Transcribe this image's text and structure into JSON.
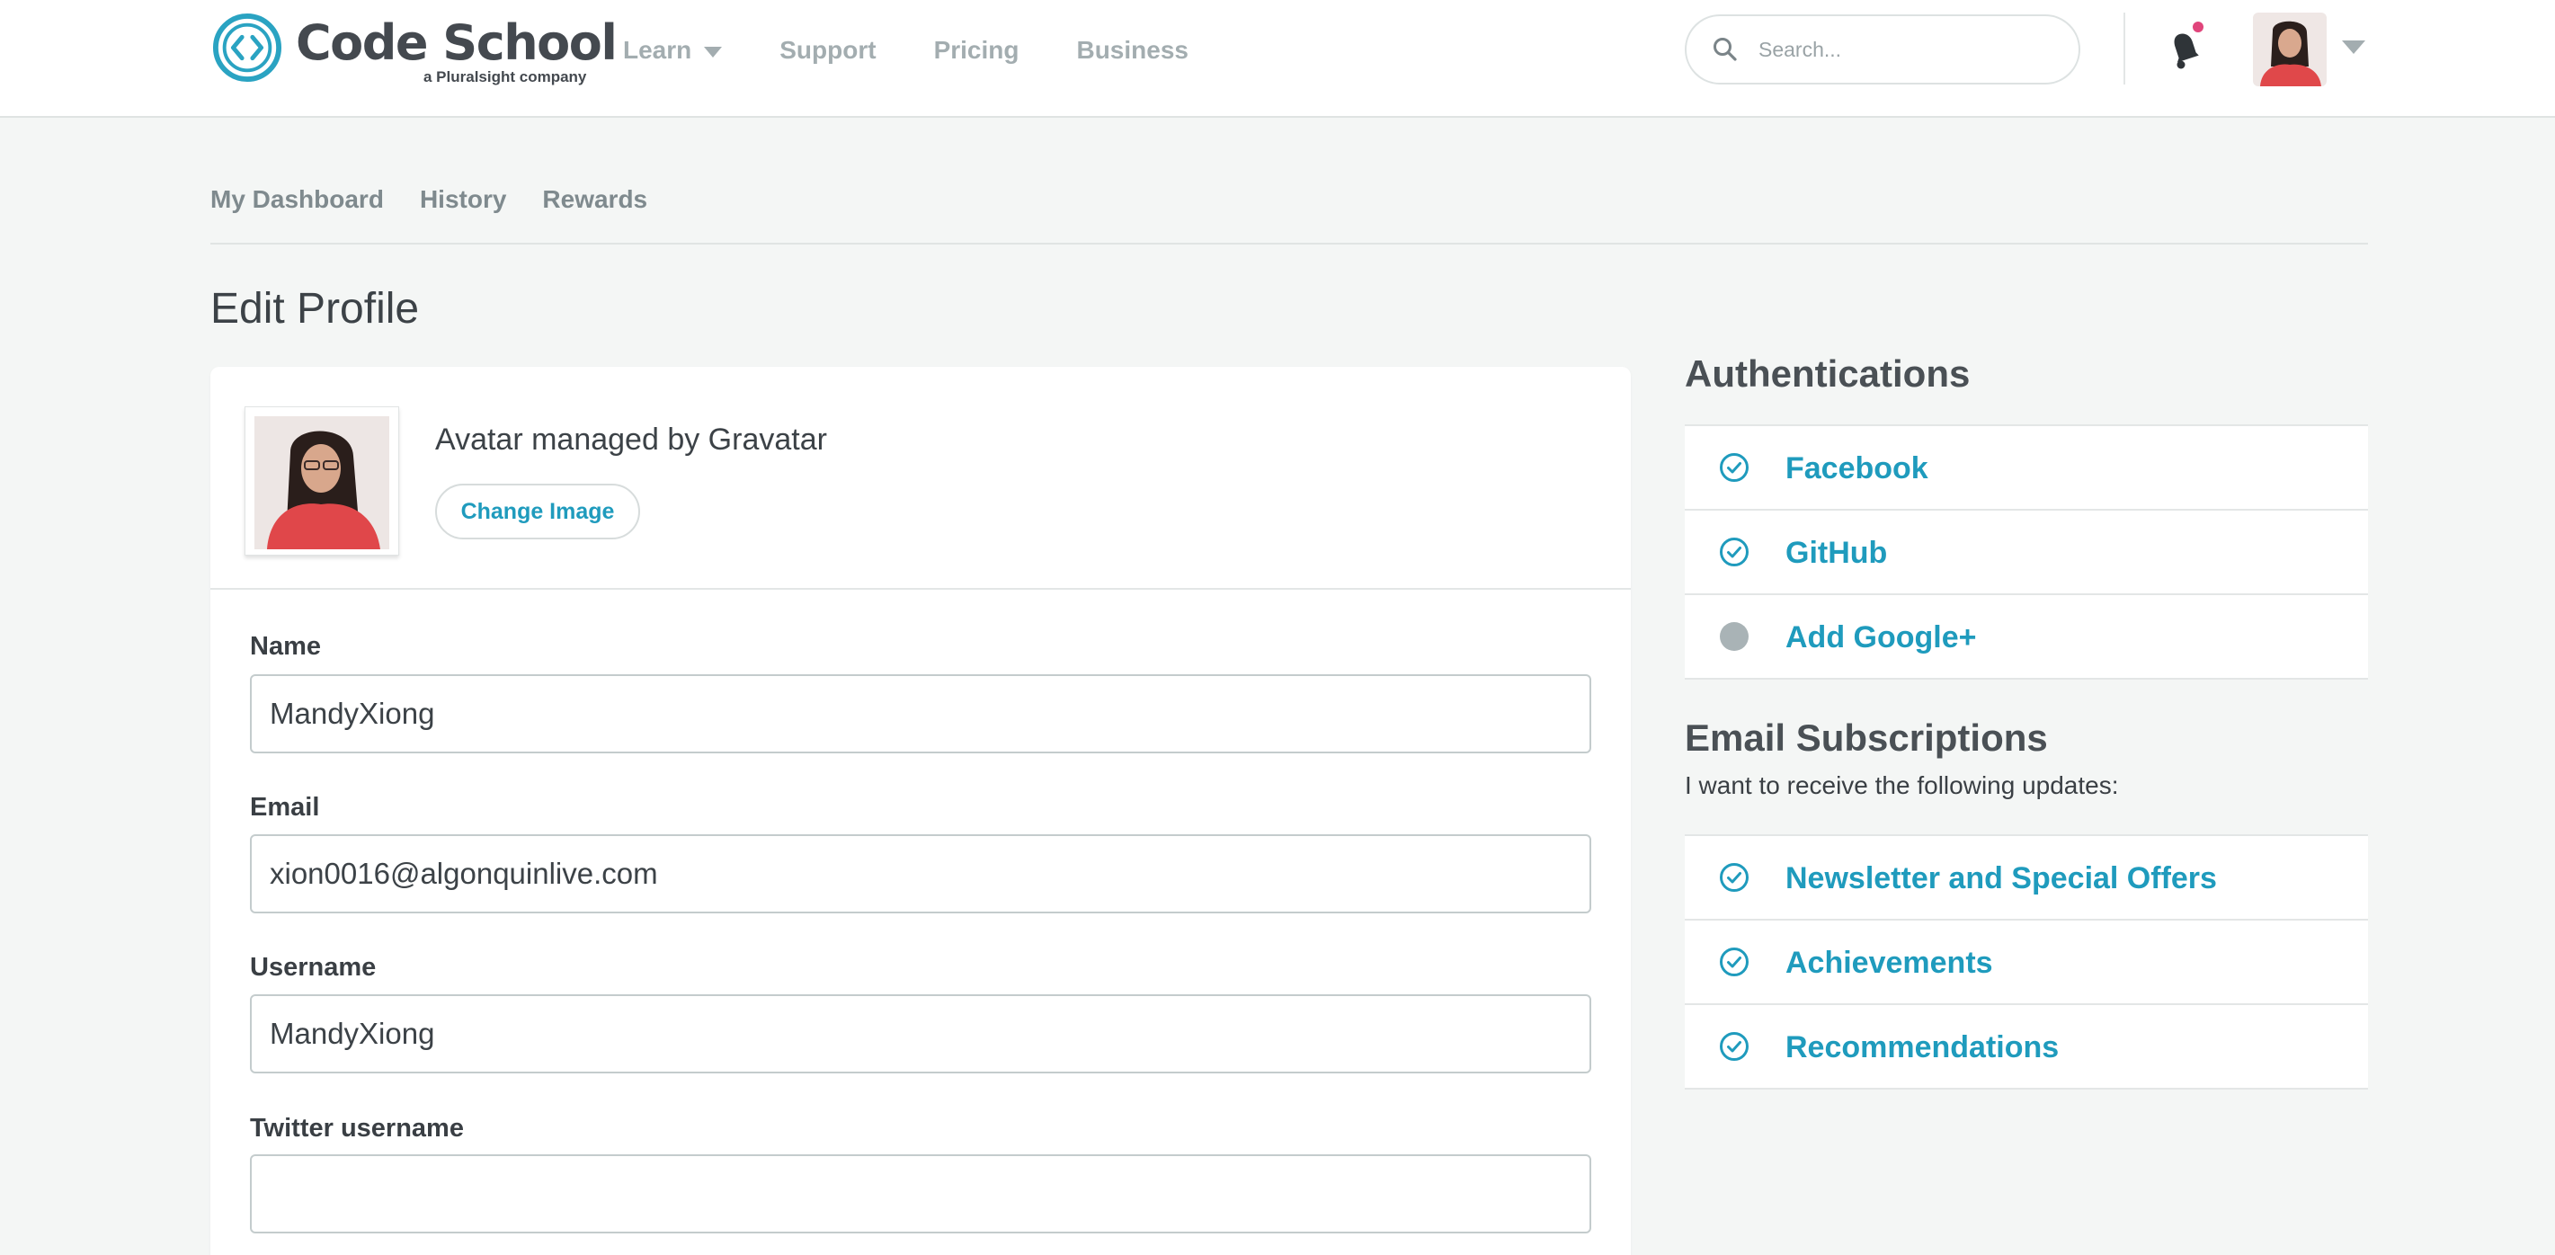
{
  "colors": {
    "accent": "#1f9bbd",
    "nav_text": "#a3adb0",
    "notification_dot": "#e0457b",
    "inactive_auth": "#a9b3b6"
  },
  "header": {
    "logo": {
      "name": "Code School",
      "tagline": "a Pluralsight company"
    },
    "nav": [
      {
        "label": "Learn",
        "has_dropdown": true
      },
      {
        "label": "Support"
      },
      {
        "label": "Pricing"
      },
      {
        "label": "Business"
      }
    ],
    "search": {
      "placeholder": "Search...",
      "value": ""
    },
    "icons": [
      "search-icon",
      "bell-icon",
      "user-avatar",
      "chevron-down-icon"
    ],
    "notifications": {
      "has_unread": true
    }
  },
  "subnav": {
    "items": [
      {
        "label": "My Dashboard"
      },
      {
        "label": "History"
      },
      {
        "label": "Rewards"
      }
    ]
  },
  "page": {
    "title": "Edit Profile"
  },
  "profile": {
    "avatar_text": "Avatar managed by Gravatar",
    "change_image_label": "Change Image",
    "fields": [
      {
        "label": "Name",
        "value": "MandyXiong",
        "placeholder": ""
      },
      {
        "label": "Email",
        "value": "xion0016@algonquinlive.com",
        "placeholder": ""
      },
      {
        "label": "Username",
        "value": "MandyXiong",
        "placeholder": ""
      },
      {
        "label": "Twitter username",
        "value": "",
        "placeholder": ""
      }
    ]
  },
  "authentications": {
    "title": "Authentications",
    "items": [
      {
        "label": "Facebook",
        "connected": true,
        "icon": "check-circle-icon"
      },
      {
        "label": "GitHub",
        "connected": true,
        "icon": "check-circle-icon"
      },
      {
        "label": "Add Google+",
        "connected": false,
        "icon": "grey-dot-icon"
      }
    ]
  },
  "email_subscriptions": {
    "title": "Email Subscriptions",
    "subtitle": "I want to receive the following updates:",
    "items": [
      {
        "label": "Newsletter and Special Offers",
        "subscribed": true,
        "icon": "check-circle-icon"
      },
      {
        "label": "Achievements",
        "subscribed": true,
        "icon": "check-circle-icon"
      },
      {
        "label": "Recommendations",
        "subscribed": true,
        "icon": "check-circle-icon"
      }
    ]
  }
}
